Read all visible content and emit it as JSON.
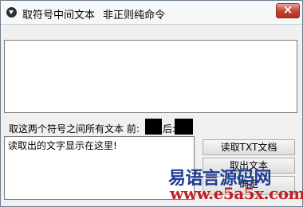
{
  "window": {
    "title": "取符号中间文本",
    "menu_label": "非正则纯命令",
    "close_label": "×"
  },
  "range_label": "取这两个符号之间所有文本 前:",
  "after_label": "后:",
  "output_text": "读取出的文字显示在这里!",
  "buttons": {
    "read_txt": "读取TXT文档",
    "extract": "取出文本",
    "third": "确定"
  },
  "watermark": {
    "cn_text": "易语言源码网",
    "url": "www.e5a5x.com",
    "colors": {
      "cn": "#1f3d95",
      "url": "#c31f24"
    }
  },
  "colors": {
    "close_button": "#c14333",
    "background": "#f0f0f0"
  }
}
